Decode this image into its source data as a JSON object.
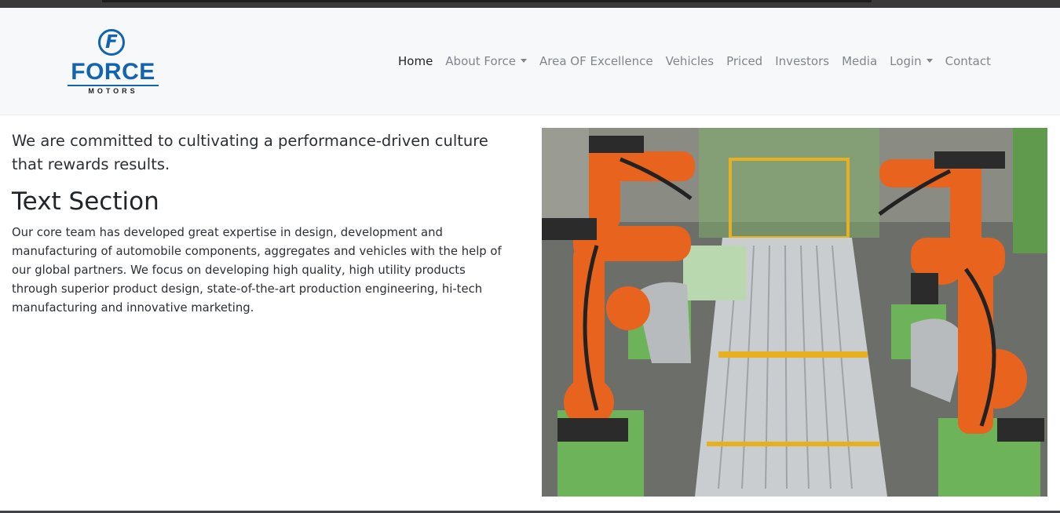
{
  "brand": {
    "logo_letter": "F",
    "logo_word": "FORCE",
    "logo_sub": "MOTORS",
    "color": "#1264b0"
  },
  "nav": {
    "items": [
      {
        "label": "Home",
        "active": true,
        "dropdown": false
      },
      {
        "label": "About Force",
        "active": false,
        "dropdown": true
      },
      {
        "label": "Area OF Excellence",
        "active": false,
        "dropdown": false
      },
      {
        "label": "Vehicles",
        "active": false,
        "dropdown": false
      },
      {
        "label": "Priced",
        "active": false,
        "dropdown": false
      },
      {
        "label": "Investors",
        "active": false,
        "dropdown": false
      },
      {
        "label": "Media",
        "active": false,
        "dropdown": false
      },
      {
        "label": "Login",
        "active": false,
        "dropdown": true
      },
      {
        "label": "Contact",
        "active": false,
        "dropdown": false
      }
    ]
  },
  "main": {
    "lead": "We are committed to cultivating a performance-driven culture that rewards results.",
    "heading": "Text Section",
    "body": "Our core team has developed great expertise in design, development and manufacturing of automobile components, aggregates and vehicles with the help of our global partners. We focus on developing high quality, high utility products through superior product design, state-of-the-art production engineering, hi-tech manufacturing and innovative marketing."
  },
  "image": {
    "subject": "robotic-welding-assembly-line",
    "robot_color": "#e8641e"
  }
}
